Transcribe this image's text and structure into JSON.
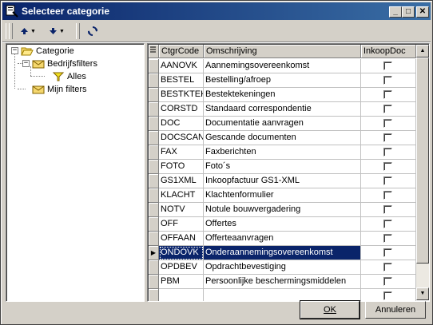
{
  "window": {
    "title": "Selecteer categorie",
    "controls": {
      "minimize": "_",
      "maximize": "□",
      "close": "✕"
    }
  },
  "toolbar": {
    "items": [
      {
        "name": "move-up",
        "icon": "arrow-up-icon"
      },
      {
        "name": "move-down",
        "icon": "arrow-down-icon"
      },
      {
        "name": "refresh",
        "icon": "refresh-icon"
      }
    ]
  },
  "tree": {
    "root": {
      "label": "Categorie",
      "expanded": true
    },
    "nodes": [
      {
        "label": "Bedrijfsfilters",
        "expanded": true
      },
      {
        "label": "Alles"
      },
      {
        "label": "Mijn filters"
      }
    ]
  },
  "grid": {
    "columns": [
      "CtgrCode",
      "Omschrijving",
      "InkoopDoc"
    ],
    "rows": [
      {
        "code": "AANOVK",
        "desc": "Aannemingsovereenkomst",
        "checked": false
      },
      {
        "code": "BESTEL",
        "desc": "Bestelling/afroep",
        "checked": false
      },
      {
        "code": "BESTKTEK",
        "desc": "Bestektekeningen",
        "checked": false
      },
      {
        "code": "CORSTD",
        "desc": "Standaard correspondentie",
        "checked": false
      },
      {
        "code": "DOC",
        "desc": "Documentatie aanvragen",
        "checked": false
      },
      {
        "code": "DOCSCAN",
        "desc": "Gescande documenten",
        "checked": false
      },
      {
        "code": "FAX",
        "desc": "Faxberichten",
        "checked": false
      },
      {
        "code": "FOTO",
        "desc": "Foto´s",
        "checked": false
      },
      {
        "code": "GS1XML",
        "desc": "Inkoopfactuur GS1-XML",
        "checked": false
      },
      {
        "code": "KLACHT",
        "desc": "Klachtenformulier",
        "checked": false
      },
      {
        "code": "NOTV",
        "desc": "Notule bouwvergadering",
        "checked": false
      },
      {
        "code": "OFF",
        "desc": "Offertes",
        "checked": false
      },
      {
        "code": "OFFAAN",
        "desc": "Offerteaanvragen",
        "checked": false
      },
      {
        "code": "ONDOVK",
        "desc": "Onderaannemingsovereenkomst",
        "checked": false,
        "selected": true
      },
      {
        "code": "OPDBEV",
        "desc": "Opdrachtbevestiging",
        "checked": false
      },
      {
        "code": "PBM",
        "desc": "Persoonlijke beschermingsmiddelen",
        "checked": false
      },
      {
        "code": "",
        "desc": "",
        "checked": false
      }
    ]
  },
  "buttons": {
    "ok": "OK",
    "cancel": "Annuleren"
  }
}
